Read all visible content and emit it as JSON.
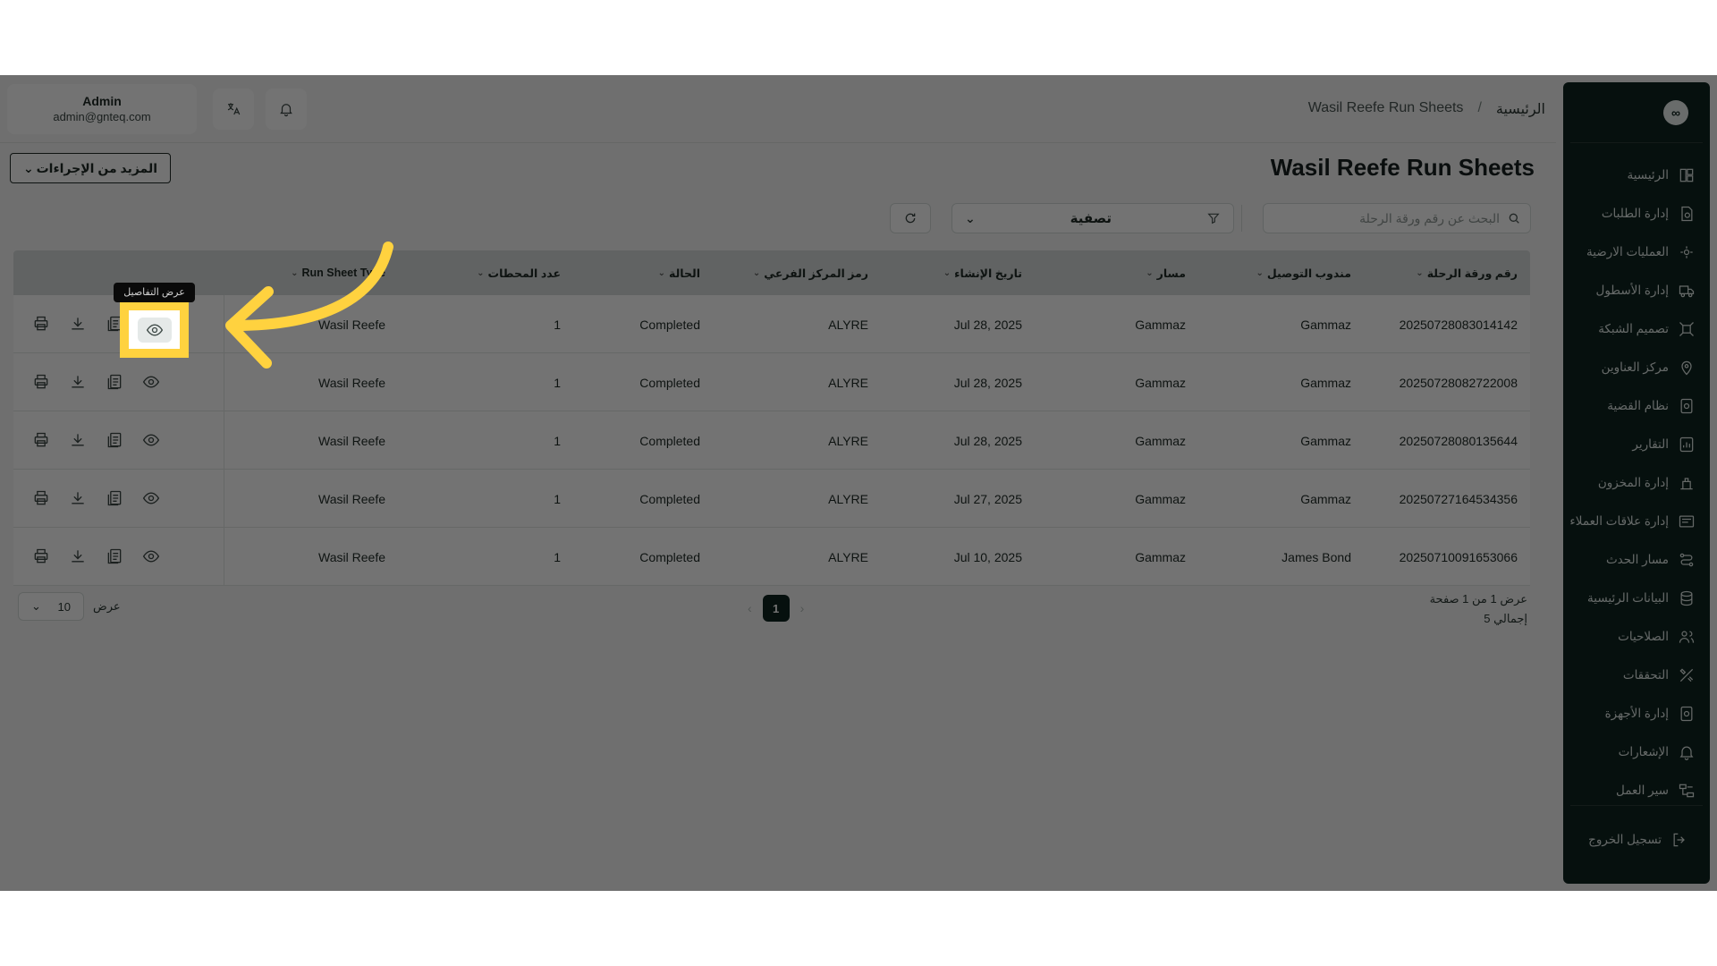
{
  "header": {
    "breadcrumb_home": "الرئيسية",
    "breadcrumb_sep": "/",
    "breadcrumb_current": "Wasil Reefe Run Sheets",
    "user_name": "Admin",
    "user_email": "admin@gnteq.com",
    "translate_icon": "translate-icon",
    "bell_icon": "bell-icon"
  },
  "sidebar": {
    "logo": "∞",
    "items": [
      {
        "label": "الرئيسية",
        "icon": "dashboard-icon"
      },
      {
        "label": "إدارة الطلبات",
        "icon": "orders-icon"
      },
      {
        "label": "العمليات الارضية",
        "icon": "ground-ops-icon"
      },
      {
        "label": "إدارة الأسطول",
        "icon": "truck-icon"
      },
      {
        "label": "تصميم الشبكة",
        "icon": "network-icon"
      },
      {
        "label": "مركز العناوين",
        "icon": "location-icon"
      },
      {
        "label": "نظام القضية",
        "icon": "case-icon"
      },
      {
        "label": "التقارير",
        "icon": "reports-icon"
      },
      {
        "label": "إدارة المخزون",
        "icon": "inventory-icon"
      },
      {
        "label": "إدارة علاقات العملاء",
        "icon": "crm-icon"
      },
      {
        "label": "مسار الحدث",
        "icon": "route-icon"
      },
      {
        "label": "البيانات الرئيسية",
        "icon": "database-icon"
      },
      {
        "label": "الصلاحيات",
        "icon": "users-icon"
      },
      {
        "label": "التحققات",
        "icon": "tools-icon"
      },
      {
        "label": "إدارة الأجهزة",
        "icon": "device-icon"
      },
      {
        "label": "الإشعارات",
        "icon": "bell-icon"
      },
      {
        "label": "سير العمل",
        "icon": "workflow-icon"
      }
    ],
    "logout": "تسجيل الخروج"
  },
  "page": {
    "title": "Wasil Reefe Run Sheets",
    "more_actions": "المزيد من الإجراءات",
    "search_placeholder": "البحث عن رقم ورقة الرحلة",
    "filter_label": "تصفية"
  },
  "table": {
    "columns": [
      "رقم ورقة الرحلة",
      "مندوب التوصيل",
      "مسار",
      "تاريخ الإنشاء",
      "رمز المركز الفرعي",
      "الحالة",
      "عدد المحطات",
      "Run Sheet Type"
    ],
    "rows": [
      {
        "id": "20250728083014142",
        "courier": "Gammaz",
        "route": "Gammaz",
        "date": "Jul 28, 2025",
        "hub": "ALYRE",
        "status": "Completed",
        "stops": "1",
        "type": "Wasil Reefe"
      },
      {
        "id": "20250728082722008",
        "courier": "Gammaz",
        "route": "Gammaz",
        "date": "Jul 28, 2025",
        "hub": "ALYRE",
        "status": "Completed",
        "stops": "1",
        "type": "Wasil Reefe"
      },
      {
        "id": "20250728080135644",
        "courier": "Gammaz",
        "route": "Gammaz",
        "date": "Jul 28, 2025",
        "hub": "ALYRE",
        "status": "Completed",
        "stops": "1",
        "type": "Wasil Reefe"
      },
      {
        "id": "20250727164534356",
        "courier": "Gammaz",
        "route": "Gammaz",
        "date": "Jul 27, 2025",
        "hub": "ALYRE",
        "status": "Completed",
        "stops": "1",
        "type": "Wasil Reefe"
      },
      {
        "id": "20250710091653066",
        "courier": "James Bond",
        "route": "Gammaz",
        "date": "Jul 10, 2025",
        "hub": "ALYRE",
        "status": "Completed",
        "stops": "1",
        "type": "Wasil Reefe"
      }
    ]
  },
  "tooltip": "عرض التفاصيل",
  "pagination": {
    "info_pages": "عرض 1 من 1 صفحة",
    "info_total": "إجمالي 5",
    "current_page": "1",
    "per_page_label": "عرض",
    "per_page_value": "10"
  },
  "colors": {
    "sidebar_bg": "#0f2420",
    "highlight": "#ffd23f",
    "arrow": "#ffd23f"
  }
}
